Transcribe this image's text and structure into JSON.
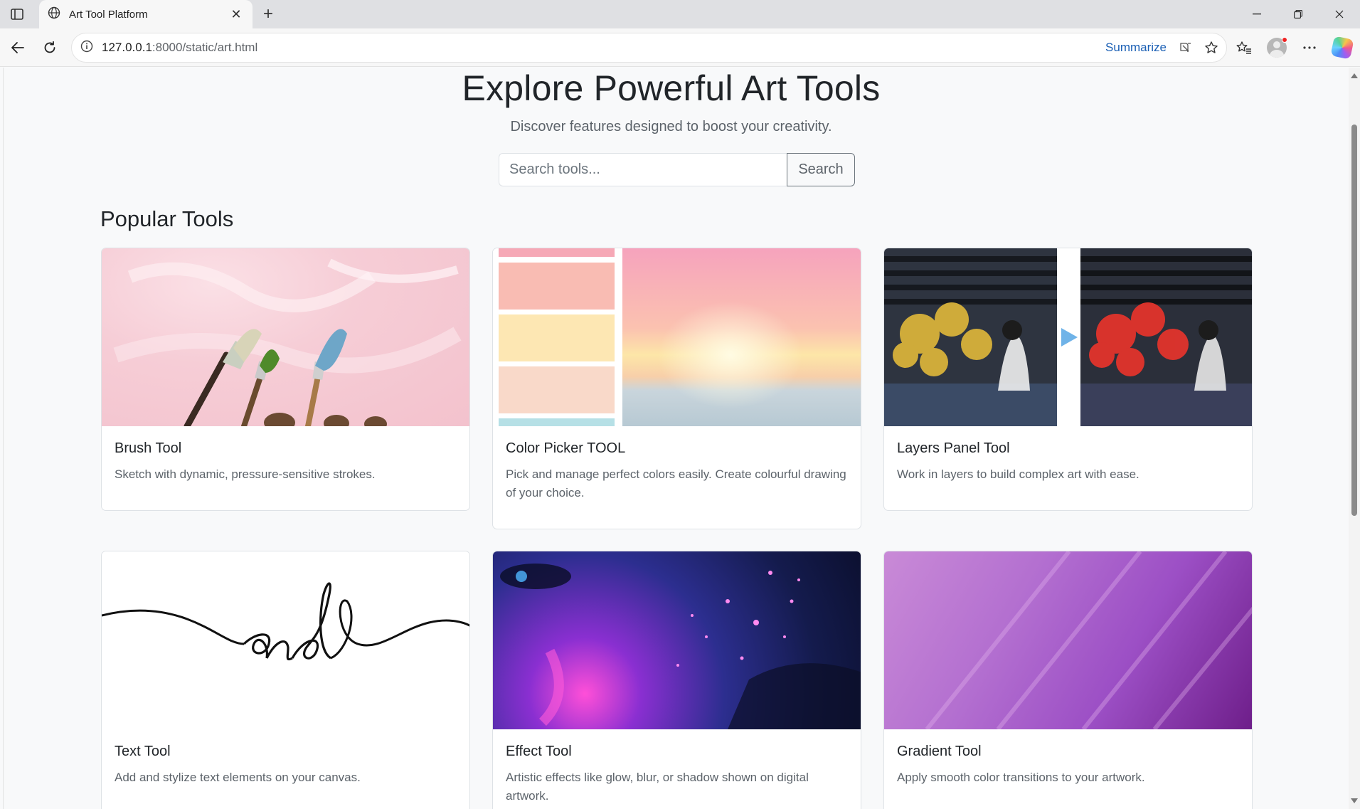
{
  "browser": {
    "tab_title": "Art Tool Platform",
    "url_host": "127.0.0.1",
    "url_path": ":8000/static/art.html",
    "summarize_label": "Summarize"
  },
  "hero": {
    "title": "Explore Powerful Art Tools",
    "subtitle": "Discover features designed to boost your creativity."
  },
  "search": {
    "placeholder": "Search tools...",
    "button_label": "Search"
  },
  "section": {
    "title": "Popular Tools"
  },
  "tools": [
    {
      "title": "Brush Tool",
      "description": "Sketch with dynamic, pressure-sensitive strokes.",
      "image": "paintbrushes-on-pink"
    },
    {
      "title": "Color Picker TOOL",
      "description": "Pick and manage perfect colors easily. Create colourful drawing of your choice.",
      "image": "palette-swatches-sunset"
    },
    {
      "title": "Layers Panel Tool",
      "description": "Work in layers to build complex art with ease.",
      "image": "layered-art-before-after"
    },
    {
      "title": "Text Tool",
      "description": "Add and stylize text elements on your canvas.",
      "image": "calligraphy-and"
    },
    {
      "title": "Effect Tool",
      "description": "Artistic effects like glow, blur, or shadow shown on digital artwork.",
      "image": "neon-glow-face"
    },
    {
      "title": "Gradient Tool",
      "description": "Apply smooth color transitions to your artwork.",
      "image": "purple-gradient"
    }
  ],
  "colors": {
    "link_blue": "#1a5fb4",
    "text_dark": "#212529",
    "text_muted": "#5c636a"
  }
}
